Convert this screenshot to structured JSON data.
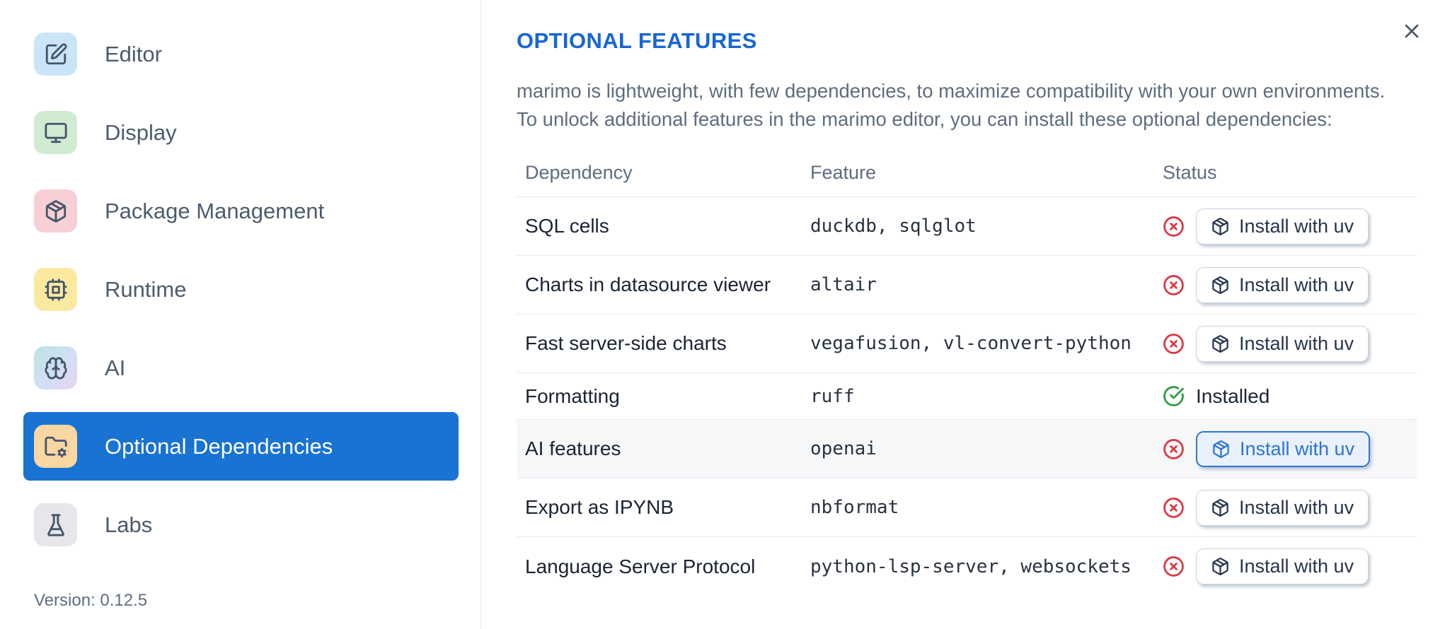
{
  "sidebar": {
    "items": [
      {
        "label": "Editor",
        "icon": "square-pen-icon",
        "icon_bg": "#cbe5f8",
        "selected": false
      },
      {
        "label": "Display",
        "icon": "monitor-icon",
        "icon_bg": "#d0ebd1",
        "selected": false
      },
      {
        "label": "Package Management",
        "icon": "package-icon",
        "icon_bg": "#f8cfd4",
        "selected": false
      },
      {
        "label": "Runtime",
        "icon": "cpu-icon",
        "icon_bg": "#fce9a0",
        "selected": false
      },
      {
        "label": "AI",
        "icon": "brain-icon",
        "icon_bg": [
          "#bde4df",
          "#cfe0f5",
          "#e9d4ee"
        ],
        "selected": false
      },
      {
        "label": "Optional Dependencies",
        "icon": "folder-cog-icon",
        "icon_bg": "#f9d6a2",
        "selected": true
      },
      {
        "label": "Labs",
        "icon": "flask-icon",
        "icon_bg": "#e6e6eb",
        "selected": false
      }
    ],
    "version_label": "Version: 0.12.5"
  },
  "panel": {
    "title": "OPTIONAL FEATURES",
    "description_line1": "marimo is lightweight, with few dependencies, to maximize compatibility with your own environments.",
    "description_line2": "To unlock additional features in the marimo editor, you can install these optional dependencies:",
    "table": {
      "columns": [
        "Dependency",
        "Feature",
        "Status"
      ],
      "install_button_label": "Install with uv",
      "installed_label": "Installed",
      "rows": [
        {
          "dependency": "SQL cells",
          "feature": "duckdb, sqlglot",
          "status": "missing",
          "highlighted": false
        },
        {
          "dependency": "Charts in datasource viewer",
          "feature": "altair",
          "status": "missing",
          "highlighted": false
        },
        {
          "dependency": "Fast server-side charts",
          "feature": "vegafusion, vl-convert-python",
          "status": "missing",
          "highlighted": false
        },
        {
          "dependency": "Formatting",
          "feature": "ruff",
          "status": "installed",
          "highlighted": false
        },
        {
          "dependency": "AI features",
          "feature": "openai",
          "status": "missing",
          "highlighted": true
        },
        {
          "dependency": "Export as IPYNB",
          "feature": "nbformat",
          "status": "missing",
          "highlighted": false
        },
        {
          "dependency": "Language Server Protocol",
          "feature": "python-lsp-server, websockets",
          "status": "missing",
          "highlighted": false
        }
      ]
    }
  },
  "colors": {
    "sidebar_selected_bg": "#1873d3",
    "title_blue": "#1766d4",
    "error_red": "#da3a45",
    "success_green": "#2f9e44",
    "active_button_blue": "#2d74d4",
    "active_button_bg": "#e9f1fc",
    "divider": "#e4e9ef",
    "highlight_row_bg": "#f6f7f9"
  }
}
